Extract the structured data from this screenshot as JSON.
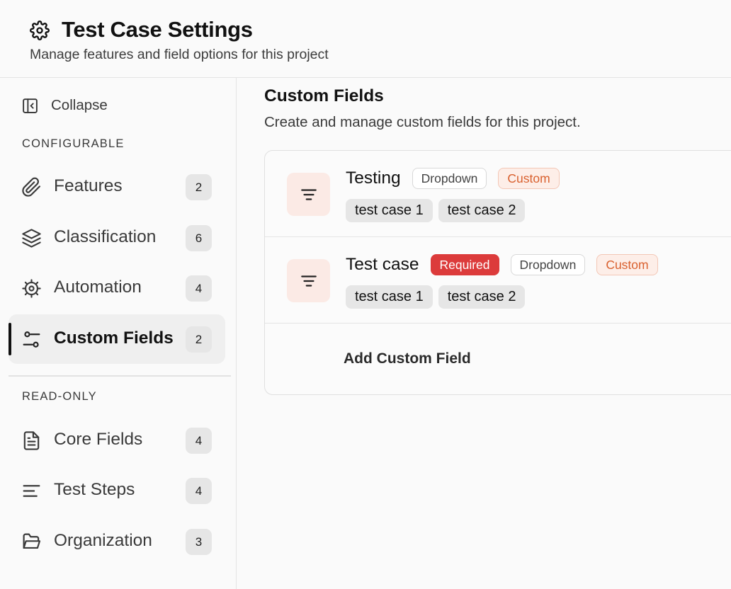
{
  "header": {
    "title": "Test Case Settings",
    "subtitle": "Manage features and field options for this project",
    "icon": "gear-icon"
  },
  "sidebar": {
    "collapse_label": "Collapse",
    "configurable_label": "CONFIGURABLE",
    "readonly_label": "READ-ONLY",
    "configurable_items": [
      {
        "label": "Features",
        "count": "2",
        "icon": "paperclip-icon"
      },
      {
        "label": "Classification",
        "count": "6",
        "icon": "layers-icon"
      },
      {
        "label": "Automation",
        "count": "4",
        "icon": "cog-icon"
      },
      {
        "label": "Custom Fields",
        "count": "2",
        "icon": "sliders-icon",
        "active": true
      }
    ],
    "readonly_items": [
      {
        "label": "Core Fields",
        "count": "4",
        "icon": "document-icon"
      },
      {
        "label": "Test Steps",
        "count": "4",
        "icon": "lines-icon"
      },
      {
        "label": "Organization",
        "count": "3",
        "icon": "folder-icon"
      }
    ]
  },
  "main": {
    "title": "Custom Fields",
    "subtitle": "Create and manage custom fields for this project.",
    "fields": [
      {
        "name": "Testing",
        "required_badge": "",
        "type_badge": "Dropdown",
        "custom_badge": "Custom",
        "options": [
          "test case 1",
          "test case 2"
        ]
      },
      {
        "name": "Test case",
        "required_badge": "Required",
        "type_badge": "Dropdown",
        "custom_badge": "Custom",
        "options": [
          "test case 1",
          "test case 2"
        ]
      }
    ],
    "add_label": "Add Custom Field"
  },
  "colors": {
    "accent_custom": "#d9602e",
    "required": "#dc3b3b",
    "field_icon_bg": "#fbeae5"
  }
}
